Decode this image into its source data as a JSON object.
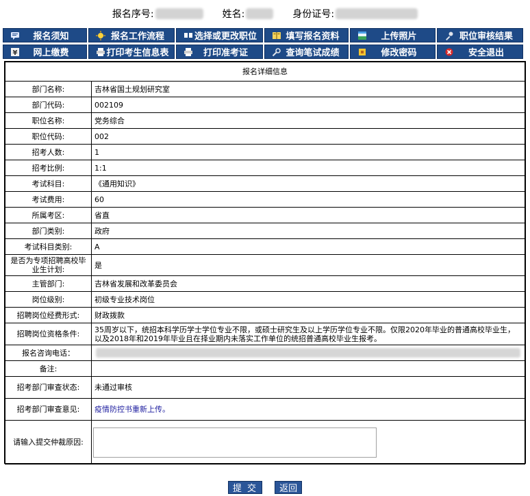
{
  "header": {
    "reg_no_label": "报名序号:",
    "name_label": "姓名:",
    "id_label": "身份证号:"
  },
  "nav": [
    {
      "label": "报名须知",
      "icon": "speech-bubble-icon"
    },
    {
      "label": "报名工作流程",
      "icon": "star-icon"
    },
    {
      "label": "选择或更改职位",
      "icon": "list-icon"
    },
    {
      "label": "填写报名资料",
      "icon": "book-icon"
    },
    {
      "label": "上传照片",
      "icon": "image-icon"
    },
    {
      "label": "职位审核结果",
      "icon": "key-icon"
    },
    {
      "label": "网上缴费",
      "icon": "yen-icon"
    },
    {
      "label": "打印考生信息表",
      "icon": "printer-icon"
    },
    {
      "label": "打印准考证",
      "icon": "printer-icon"
    },
    {
      "label": "查询笔试成绩",
      "icon": "search-icon"
    },
    {
      "label": "修改密码",
      "icon": "lock-icon"
    },
    {
      "label": "安全退出",
      "icon": "exit-icon"
    }
  ],
  "detail": {
    "title": "报名详细信息",
    "rows": [
      {
        "label": "部门名称:",
        "value": "吉林省国土规划研究室"
      },
      {
        "label": "部门代码:",
        "value": "002109"
      },
      {
        "label": "职位名称:",
        "value": "党务综合"
      },
      {
        "label": "职位代码:",
        "value": "002"
      },
      {
        "label": "招考人数:",
        "value": "1"
      },
      {
        "label": "招考比例:",
        "value": "1:1"
      },
      {
        "label": "考试科目:",
        "value": "《通用知识》"
      },
      {
        "label": "考试费用:",
        "value": "60"
      },
      {
        "label": "所属考区:",
        "value": "省直"
      },
      {
        "label": "部门类别:",
        "value": "政府"
      },
      {
        "label": "考试科目类别:",
        "value": "A"
      },
      {
        "label": "是否为专项招聘高校毕业生计划:",
        "value": "是"
      },
      {
        "label": "主管部门:",
        "value": "吉林省发展和改革委员会"
      },
      {
        "label": "岗位级别:",
        "value": "初级专业技术岗位"
      },
      {
        "label": "招聘岗位经费形式:",
        "value": "财政拨款"
      },
      {
        "label": "招聘岗位资格条件:",
        "value": "35周岁以下，统招本科学历学士学位专业不限，或硕士研究生及以上学历学位专业不限。仅限2020年毕业的普通高校毕业生，以及2018年和2019年毕业且在择业期内未落实工作单位的统招普通高校毕业生报考。"
      }
    ],
    "phone_label": "报名咨询电话：",
    "remark_label": "备注:",
    "remark_value": "",
    "review_status_label": "招考部门审查状态:",
    "review_status_value": "未通过审核",
    "review_opinion_label": "招考部门审查意见:",
    "review_opinion_value": "疫情防控书重新上传。",
    "appeal_label": "请输入提交仲裁原因:",
    "appeal_value": ""
  },
  "buttons": {
    "submit": "提 交",
    "back": "返回"
  },
  "colors": {
    "nav_bg": "#1e4a87",
    "button_bg": "#2a5598",
    "opinion_text": "#2020a0"
  }
}
